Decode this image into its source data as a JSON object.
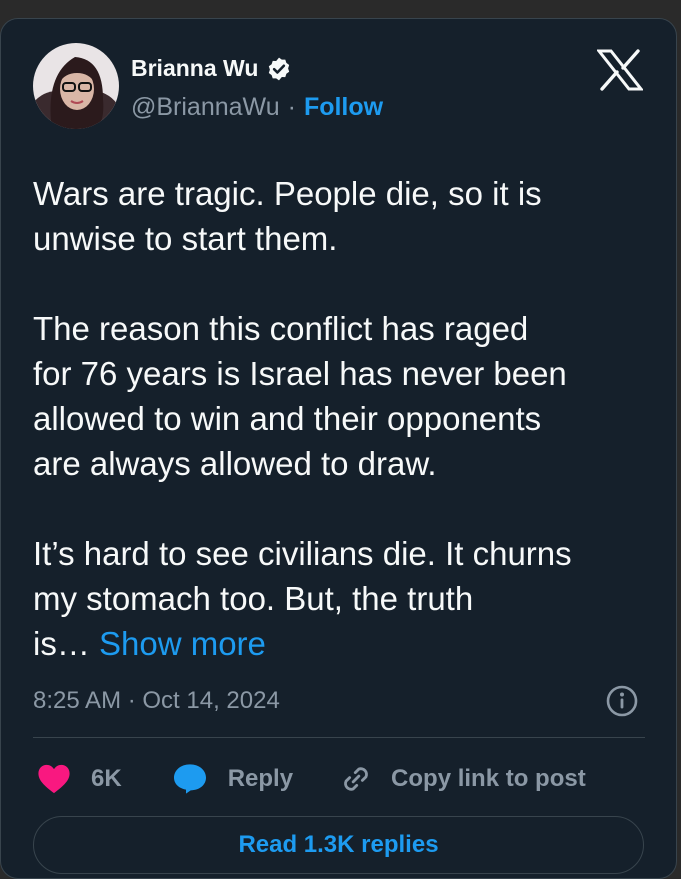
{
  "author": {
    "name": "Brianna Wu",
    "handle": "@BriannaWu",
    "separator": "·",
    "follow_label": "Follow",
    "verified": true
  },
  "brand": {
    "icon": "x-logo-icon"
  },
  "tweet": {
    "text": "Wars are tragic. People die, so it is\nunwise to start them.\n\nThe reason this conflict has raged\nfor 76 years is Israel has never been\nallowed to win and their opponents\nare always allowed to draw.\n\nIt’s hard to see civilians die. It churns\nmy stomach too. But, the truth\nis… ",
    "show_more_label": "Show more"
  },
  "meta": {
    "timestamp": "8:25 AM · Oct 14, 2024"
  },
  "actions": {
    "likes": "6K",
    "reply_label": "Reply",
    "copy_label": "Copy link to post"
  },
  "replies_button": "Read 1.3K replies",
  "colors": {
    "background": "#15202b",
    "accent": "#1d9bf0",
    "heart": "#f91880",
    "muted": "#8b98a5",
    "text": "#f7f9f9"
  }
}
